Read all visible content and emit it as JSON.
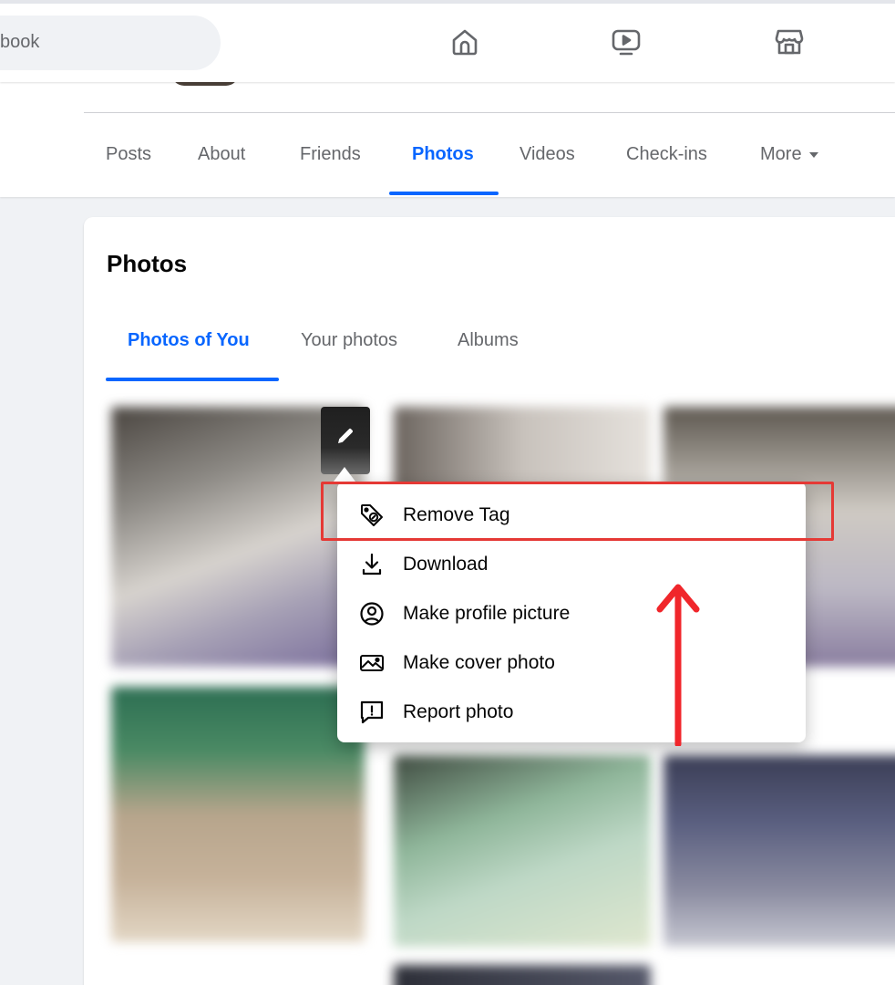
{
  "topbar": {
    "search_text": "book",
    "nav_icons": [
      "home-icon",
      "watch-icon",
      "marketplace-icon"
    ]
  },
  "profile_tabs": [
    {
      "label": "Posts",
      "active": false
    },
    {
      "label": "About",
      "active": false
    },
    {
      "label": "Friends",
      "active": false
    },
    {
      "label": "Photos",
      "active": true
    },
    {
      "label": "Videos",
      "active": false
    },
    {
      "label": "Check-ins",
      "active": false
    },
    {
      "label": "More",
      "active": false
    }
  ],
  "photos_card": {
    "title": "Photos",
    "tabs": [
      {
        "label": "Photos of You",
        "active": true
      },
      {
        "label": "Your photos",
        "active": false
      },
      {
        "label": "Albums",
        "active": false
      }
    ]
  },
  "photo_menu": {
    "items": [
      {
        "label": "Remove Tag",
        "icon": "tag-remove-icon",
        "highlighted": true
      },
      {
        "label": "Download",
        "icon": "download-icon"
      },
      {
        "label": "Make profile picture",
        "icon": "profile-picture-icon"
      },
      {
        "label": "Make cover photo",
        "icon": "cover-photo-icon"
      },
      {
        "label": "Report photo",
        "icon": "report-icon"
      }
    ]
  },
  "colors": {
    "accent": "#0866ff",
    "annotation": "#e53935",
    "text_secondary": "#65676b",
    "background": "#f0f2f5"
  }
}
